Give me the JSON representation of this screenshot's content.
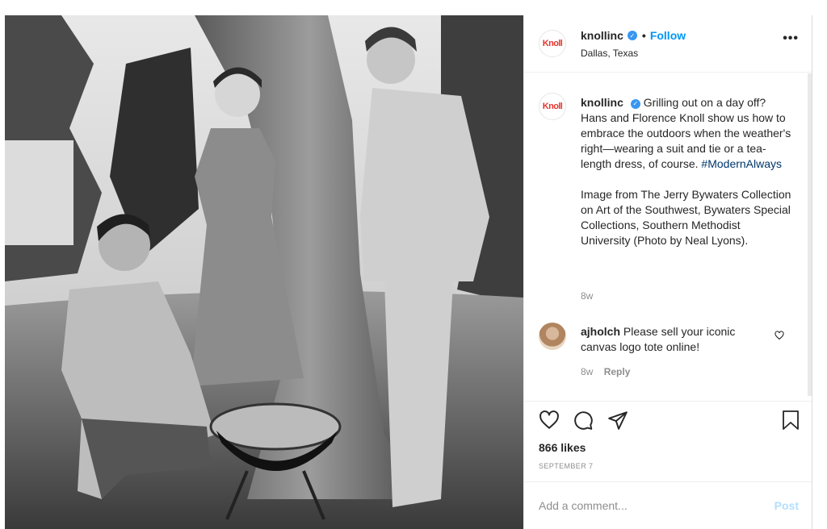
{
  "post": {
    "username": "knollinc",
    "verified_mark": "✓",
    "dot": "•",
    "follow_label": "Follow",
    "location": "Dallas, Texas",
    "more_label": "•••",
    "avatar_text": "Knoll"
  },
  "caption": {
    "username": "knollinc",
    "text": "Grilling out on a day off? Hans and Florence Knoll show us how to embrace the outdoors when the weather's right—wearing a suit and tie or a tea-length dress, of course.",
    "hashtag": "#ModernAlways",
    "credit": "Image from The Jerry Bywaters Collection on Art of the Southwest, Bywaters Special Collections, Southern Methodist University (Photo by Neal Lyons).",
    "time": "8w"
  },
  "comment": {
    "username": "ajholch",
    "text": "Please sell your iconic canvas logo tote online!",
    "time": "8w",
    "reply_label": "Reply"
  },
  "actions": {
    "icons": [
      "heart-icon",
      "comment-icon",
      "share-icon",
      "bookmark-icon"
    ],
    "likes": "866 likes",
    "date": "SEPTEMBER 7"
  },
  "add_comment": {
    "placeholder": "Add a comment...",
    "post_label": "Post"
  },
  "colors": {
    "link_blue": "#0095f6",
    "knoll_red": "#e5362d",
    "muted": "#8e8e8e"
  }
}
